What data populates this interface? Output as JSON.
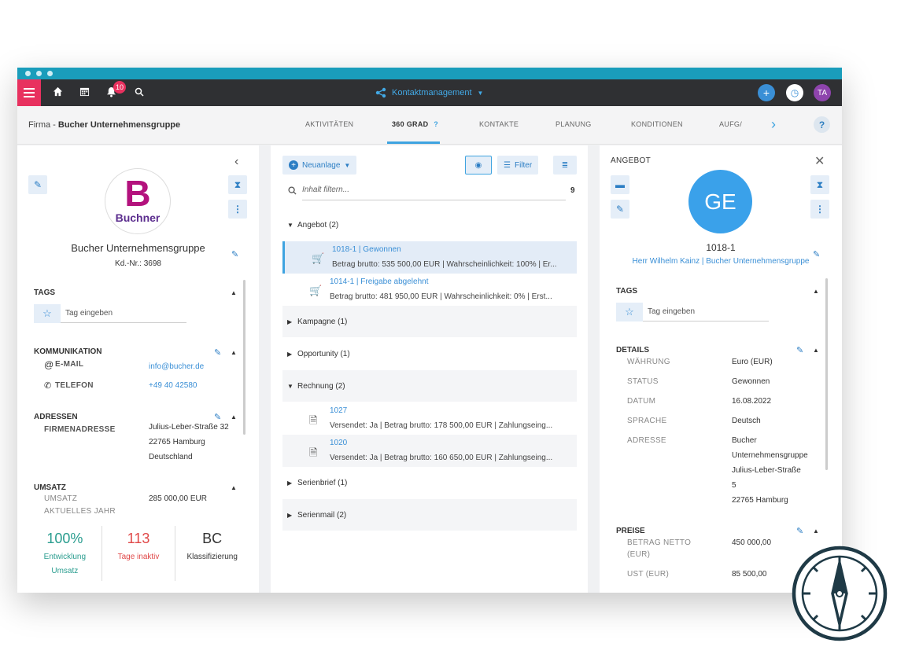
{
  "topbar": {
    "notification_count": "10",
    "app_title": "Kontaktmanagement",
    "avatar": "TA"
  },
  "breadcrumb": {
    "prefix": "Firma -",
    "name": "Bucher Unternehmensgruppe"
  },
  "tabs": [
    "AKTIVITÄTEN",
    "360 GRAD",
    "KONTAKTE",
    "PLANUNG",
    "KONDITIONEN",
    "AUFG/"
  ],
  "tab_help": "?",
  "help": "?",
  "left": {
    "logo_letter": "B",
    "logo_text": "Buchner",
    "company": "Bucher Unternehmensgruppe",
    "customer_no": "Kd.-Nr.: 3698",
    "tags_title": "TAGS",
    "tag_placeholder": "Tag eingeben",
    "comm_title": "KOMMUNIKATION",
    "email_label": "E-MAIL",
    "email": "info@bucher.de",
    "phone_label": "TELEFON",
    "phone": "+49 40 42580",
    "addr_title": "ADRESSEN",
    "addr_label": "FIRMENADRESSE",
    "addr_lines": [
      "Julius-Leber-Straße 32",
      "22765 Hamburg",
      "Deutschland"
    ],
    "umsatz_title": "UMSATZ",
    "umsatz_label": [
      "UMSATZ",
      "AKTUELLES JAHR"
    ],
    "umsatz_value": "285 000,00 EUR",
    "kpis": [
      {
        "value": "100%",
        "label1": "Entwicklung",
        "label2": "Umsatz",
        "color": "#2a9d8f"
      },
      {
        "value": "113",
        "label1": "Tage inaktiv",
        "label2": "",
        "color": "#e04848"
      },
      {
        "value": "BC",
        "label1": "Klassifizierung",
        "label2": "",
        "color": "#333333"
      }
    ]
  },
  "middle": {
    "new_button": "Neuanlage",
    "filter_button": "Filter",
    "search_placeholder": "Inhalt filtern...",
    "count": "9",
    "groups": {
      "angebot": "Angebot (2)",
      "kampagne": "Kampagne (1)",
      "opportunity": "Opportunity (1)",
      "rechnung": "Rechnung (2)",
      "serienbrief": "Serienbrief (1)",
      "serienmail": "Serienmail (2)"
    },
    "angebot_items": [
      {
        "title": "1018-1 | Gewonnen",
        "detail": "Betrag brutto: 535 500,00 EUR | Wahrscheinlichkeit: 100% | Er..."
      },
      {
        "title": "1014-1 | Freigabe abgelehnt",
        "detail": "Betrag brutto: 481 950,00 EUR | Wahrscheinlichkeit: 0% | Erst..."
      }
    ],
    "rechnung_items": [
      {
        "title": "1027",
        "detail": "Versendet: Ja | Betrag brutto: 178 500,00 EUR | Zahlungseing..."
      },
      {
        "title": "1020",
        "detail": "Versendet: Ja | Betrag brutto: 160 650,00 EUR | Zahlungseing..."
      }
    ]
  },
  "right": {
    "heading": "ANGEBOT",
    "avatar": "GE",
    "number": "1018-1",
    "contact": "Herr Wilhelm Kainz | Bucher Unternehmensgruppe",
    "tags_title": "TAGS",
    "tag_placeholder": "Tag eingeben",
    "details_title": "DETAILS",
    "details": [
      {
        "label": "WÄHRUNG",
        "value": "Euro (EUR)"
      },
      {
        "label": "STATUS",
        "value": "Gewonnen"
      },
      {
        "label": "DATUM",
        "value": "16.08.2022"
      },
      {
        "label": "SPRACHE",
        "value": "Deutsch"
      }
    ],
    "address_label": "ADRESSE",
    "address_lines": [
      "Bucher",
      "Unternehmensgruppe",
      "Julius-Leber-Straße",
      "5",
      "22765 Hamburg"
    ],
    "preise_title": "PREISE",
    "netto_label": [
      "BETRAG NETTO",
      "(EUR)"
    ],
    "netto_value": "450 000,00",
    "ust_label": "UST (EUR)",
    "ust_value": "85 500,00"
  },
  "colors": {
    "accent": "#3ea3e0",
    "brand": "#e8315f",
    "titlebar": "#1a9dbb",
    "topbar": "#2f3033",
    "avatar": "#3aa1ea"
  }
}
